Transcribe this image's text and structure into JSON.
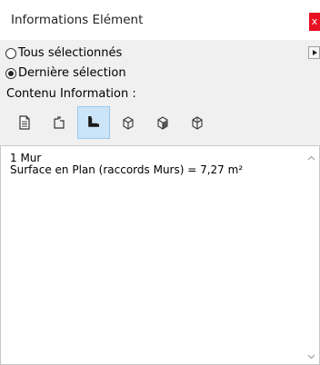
{
  "window": {
    "title": "Informations Elément",
    "close_label": "x"
  },
  "selection": {
    "options": [
      {
        "label": "Tous sélectionnés",
        "checked": false
      },
      {
        "label": "Dernière sélection",
        "checked": true
      }
    ]
  },
  "section_label": "Contenu Information :",
  "toolbar": {
    "icons": [
      "document-icon",
      "element-icon",
      "floor-plan-icon",
      "3d-box-icon",
      "3d-front-icon",
      "3d-back-icon"
    ],
    "active_index": 2
  },
  "content": {
    "line1": "1 Mur",
    "line2": "Surface en Plan (raccords Murs) = 7,27 m²"
  },
  "colors": {
    "accent_close": "#e81123",
    "active_button": "#cce4f7"
  }
}
